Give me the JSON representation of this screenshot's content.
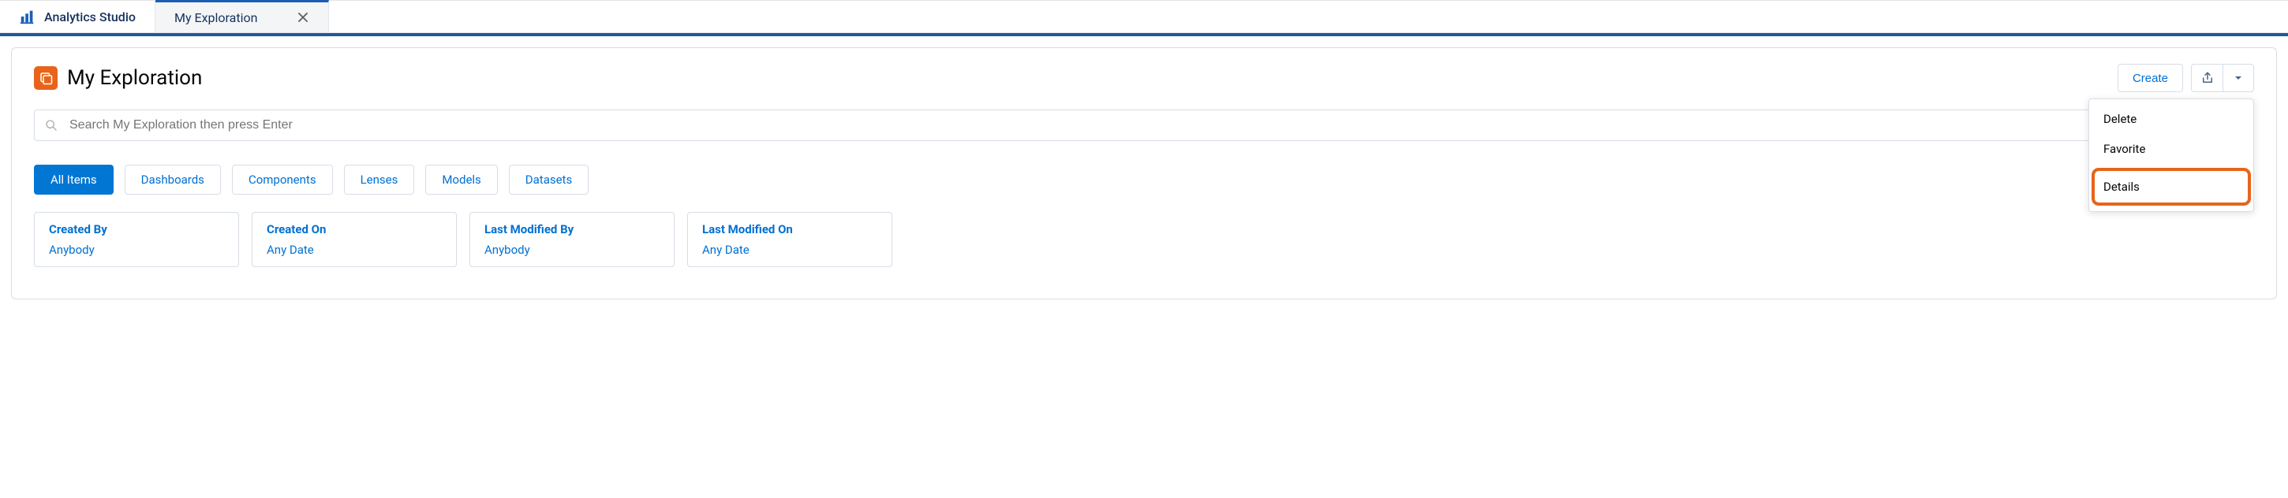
{
  "tabs": {
    "home_label": "Analytics Studio",
    "active_label": "My Exploration"
  },
  "page": {
    "title": "My Exploration",
    "search_placeholder": "Search My Exploration then press Enter"
  },
  "actions": {
    "create_label": "Create"
  },
  "dropdown": {
    "delete": "Delete",
    "favorite": "Favorite",
    "details": "Details"
  },
  "pills": {
    "all": "All Items",
    "dashboards": "Dashboards",
    "components": "Components",
    "lenses": "Lenses",
    "models": "Models",
    "datasets": "Datasets"
  },
  "filters": {
    "created_by": {
      "title": "Created By",
      "value": "Anybody"
    },
    "created_on": {
      "title": "Created On",
      "value": "Any Date"
    },
    "modified_by": {
      "title": "Last Modified By",
      "value": "Anybody"
    },
    "modified_on": {
      "title": "Last Modified On",
      "value": "Any Date"
    }
  }
}
